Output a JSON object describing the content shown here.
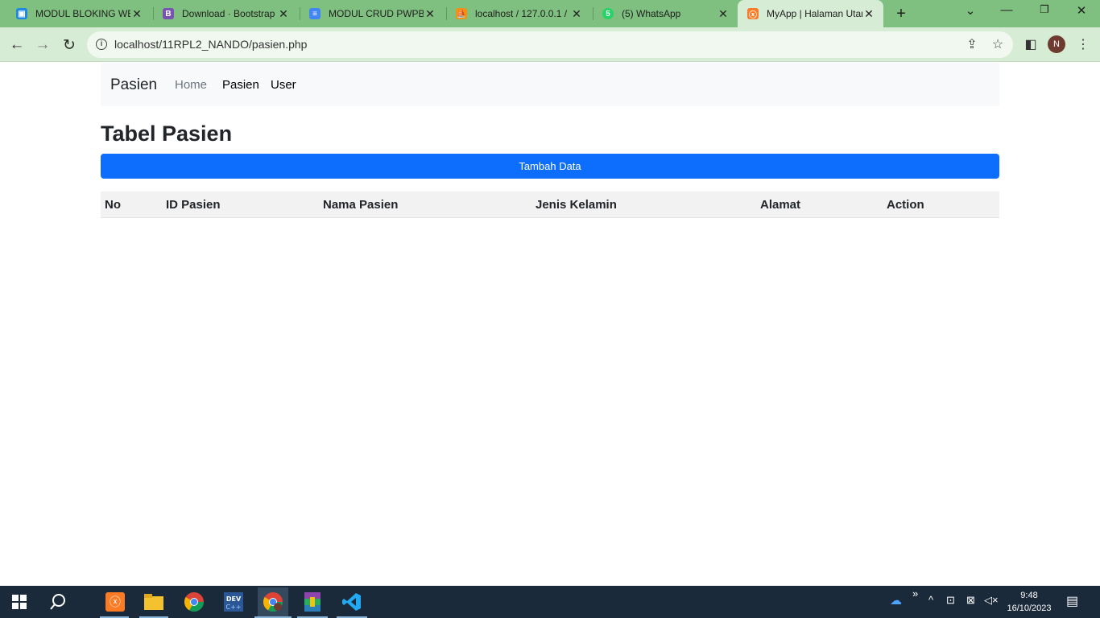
{
  "browser": {
    "tabs": [
      {
        "title": "MODUL BLOKING WEB",
        "icon": "google-classroom-icon"
      },
      {
        "title": "Download · Bootstrap",
        "icon": "bootstrap-icon"
      },
      {
        "title": "MODUL CRUD PWPB",
        "icon": "google-docs-icon"
      },
      {
        "title": "localhost / 127.0.0.1 /",
        "icon": "phpmyadmin-icon"
      },
      {
        "title": "(5) WhatsApp",
        "icon": "whatsapp-icon"
      },
      {
        "title": "MyApp | Halaman Utama",
        "icon": "xampp-icon"
      }
    ],
    "active_tab": 5,
    "url": "localhost/11RPL2_NANDO/pasien.php",
    "profile_initial": "N"
  },
  "navbar": {
    "brand": "Pasien",
    "links": [
      "Home",
      "Pasien",
      "User"
    ]
  },
  "main": {
    "heading": "Tabel Pasien",
    "add_button": "Tambah Data",
    "columns": [
      "No",
      "ID Pasien",
      "Nama Pasien",
      "Jenis Kelamin",
      "Alamat",
      "Action"
    ],
    "rows": []
  },
  "taskbar": {
    "time": "9:48",
    "date": "16/10/2023",
    "apps": [
      "start-icon",
      "search-icon",
      "xampp-icon",
      "file-explorer-icon",
      "chrome-icon",
      "devc-icon",
      "chrome-profile-icon",
      "winrar-icon",
      "vscode-icon"
    ]
  },
  "colors": {
    "tabstrip": "#7fbf7f",
    "toolbar": "#d6ecd4",
    "primary_button": "#0d6efd",
    "taskbar": "#1b2a3a"
  }
}
